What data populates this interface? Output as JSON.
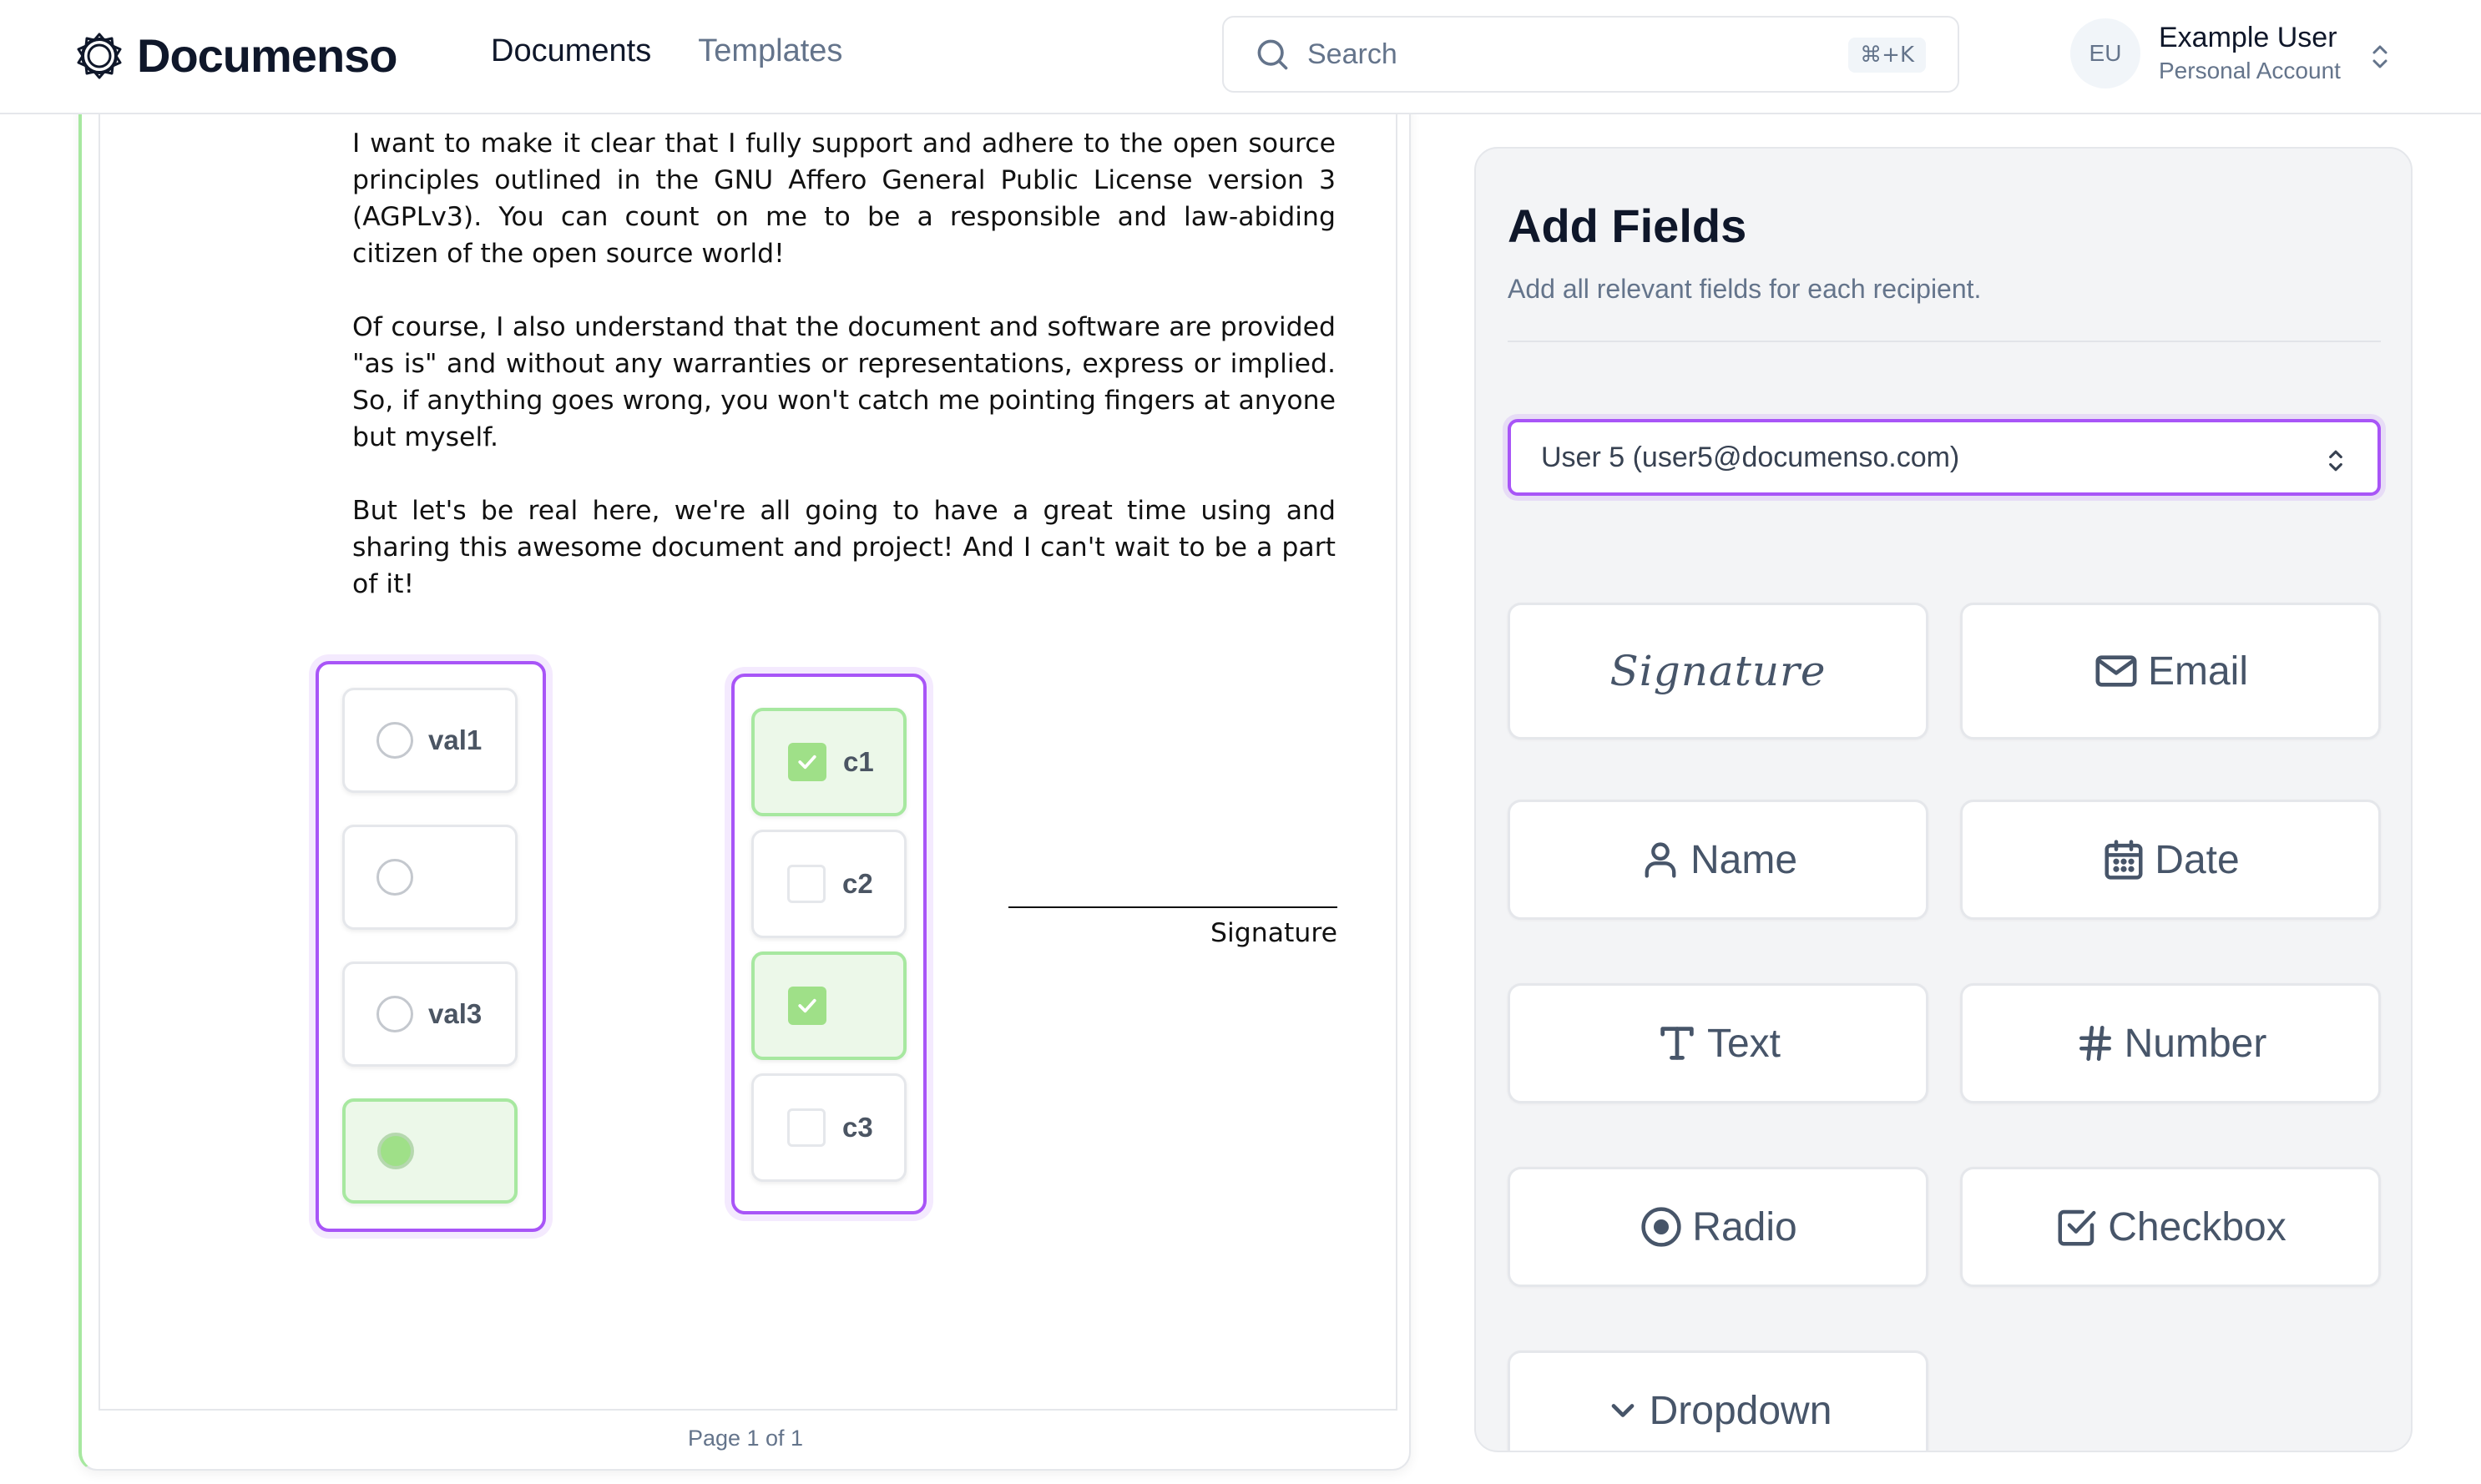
{
  "header": {
    "brand": "Documenso",
    "nav": [
      {
        "label": "Documents",
        "active": true
      },
      {
        "label": "Templates",
        "active": false
      }
    ],
    "search": {
      "label": "Search",
      "shortcut": "⌘+K"
    },
    "account": {
      "initials": "EU",
      "name": "Example User",
      "type": "Personal Account"
    }
  },
  "document": {
    "paragraphs": [
      "I want to make it clear that I fully support and adhere to the open source principles outlined in the GNU Affero General Public License version 3 (AGPLv3). You can count on me to be a responsible and law-abiding citizen of the open source world!",
      "Of course, I also understand that the document and software are provided \"as is\" and without any warranties or representations, express or implied. So, if anything goes wrong, you won't catch me pointing fingers at anyone but myself.",
      "But let's be real here, we're all going to have a great time using and sharing this awesome document and project! And I can't wait to be a part of it!"
    ],
    "radio_group": [
      {
        "label": "val1",
        "selected": false
      },
      {
        "label": "",
        "selected": false
      },
      {
        "label": "val3",
        "selected": false
      },
      {
        "label": "",
        "selected": true
      }
    ],
    "checkbox_group": [
      {
        "label": "c1",
        "checked": true
      },
      {
        "label": "c2",
        "checked": false
      },
      {
        "label": "",
        "checked": true
      },
      {
        "label": "c3",
        "checked": false
      }
    ],
    "signature_label": "Signature",
    "page_indicator": "Page 1 of 1"
  },
  "panel": {
    "title": "Add Fields",
    "subtitle": "Add all relevant fields for each recipient.",
    "recipient": "User 5 (user5@documenso.com)",
    "fields": {
      "signature": "Signature",
      "email": "Email",
      "name": "Name",
      "date": "Date",
      "text": "Text",
      "number": "Number",
      "radio": "Radio",
      "checkbox": "Checkbox",
      "dropdown": "Dropdown"
    }
  },
  "colors": {
    "accent_purple": "#a855f7",
    "field_green": "#a7e8a0",
    "check_green": "#9fe088",
    "muted_text": "#64748b"
  }
}
